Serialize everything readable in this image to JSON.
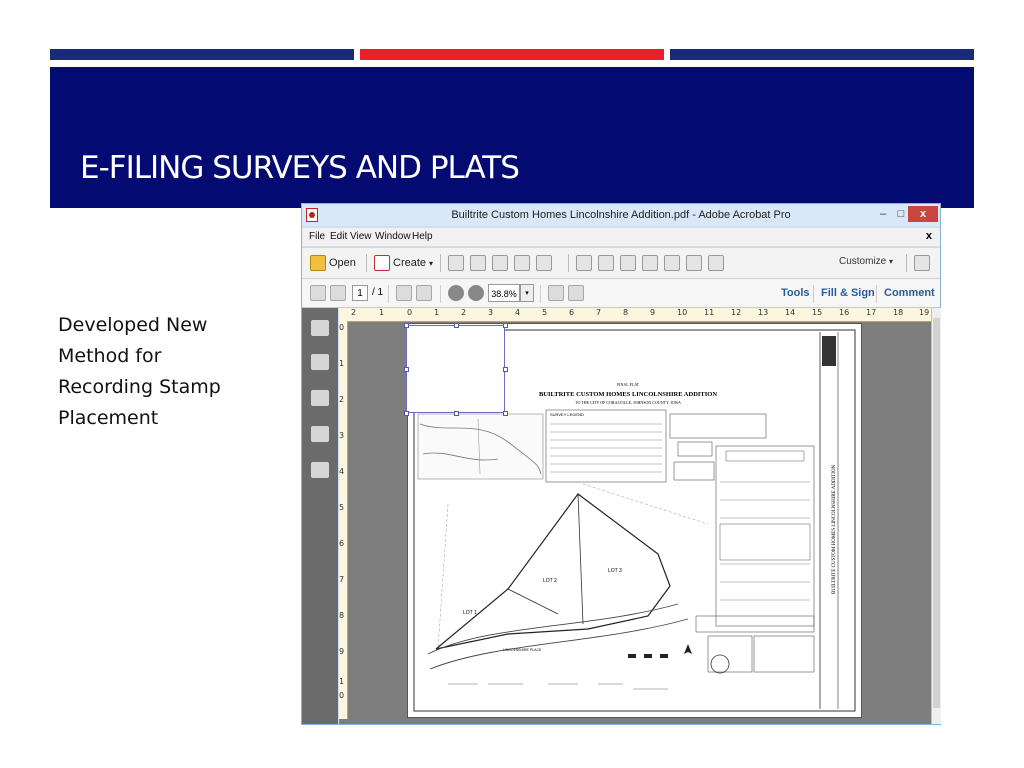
{
  "slide": {
    "title": "E-FILING SURVEYS AND PLATS",
    "body_lines": [
      "Developed New",
      "Method for",
      "Recording Stamp",
      "Placement"
    ]
  },
  "colors": {
    "banner": "#030a72",
    "stripe_blue": "#1a2a7a",
    "stripe_red": "#e8202a",
    "acrobat_link": "#2b5c9a",
    "close_button": "#c9453d"
  },
  "acrobat": {
    "window_title": "Builtrite Custom Homes Lincolnshire Addition.pdf - Adobe Acrobat Pro",
    "window_buttons": {
      "minimize": "–",
      "maximize": "□",
      "close": "x"
    },
    "menu": [
      "File",
      "Edit",
      "View",
      "Window",
      "Help"
    ],
    "menu_close": "x",
    "toolbar": {
      "open_label": "Open",
      "create_label": "Create",
      "create_dropdown": "▾",
      "icons": [
        "save-icon",
        "upload-icon",
        "print-icon",
        "edit-icon",
        "email-icon",
        "settings-icon",
        "comment-icon",
        "highlight-icon",
        "page-icon",
        "page-extract-icon",
        "page-insert-icon",
        "secure-icon"
      ],
      "customize_label": "Customize",
      "customize_dropdown": "▾"
    },
    "nav_toolbar": {
      "page_current": "1",
      "page_total": "/ 1",
      "zoom": "38.8%",
      "zoom_dropdown": "▾"
    },
    "panels": [
      "Tools",
      "Fill & Sign",
      "Comment"
    ],
    "nav_panel_icons": [
      "pages-icon",
      "bookmarks-icon",
      "attachments-icon",
      "layers-icon",
      "signatures-icon"
    ],
    "ruler_top": [
      "2",
      "1",
      "0",
      "1",
      "2",
      "3",
      "4",
      "5",
      "6",
      "7",
      "8",
      "9",
      "10",
      "11",
      "12",
      "13",
      "14",
      "15",
      "16",
      "17",
      "18",
      "19"
    ],
    "ruler_left": [
      "0",
      "1",
      "2",
      "3",
      "4",
      "5",
      "6",
      "7",
      "8",
      "9",
      "1",
      "0"
    ],
    "document": {
      "plat_heading": "FINAL PLAT",
      "plat_title": "BUILTRITE CUSTOM HOMES LINCOLNSHIRE ADDITION",
      "plat_subtitle": "TO THE CITY OF CORALVILLE, JOHNSON COUNTY, IOWA",
      "legend_title": "SURVEY LEGEND",
      "lot_labels": [
        "LOT 1",
        "LOT 2",
        "LOT 3"
      ],
      "street_label": "LINCOLNSHIRE PLACE",
      "side_title": "BUILTRITE CUSTOM HOMES LINCOLNSHIRE ADDITION"
    }
  }
}
